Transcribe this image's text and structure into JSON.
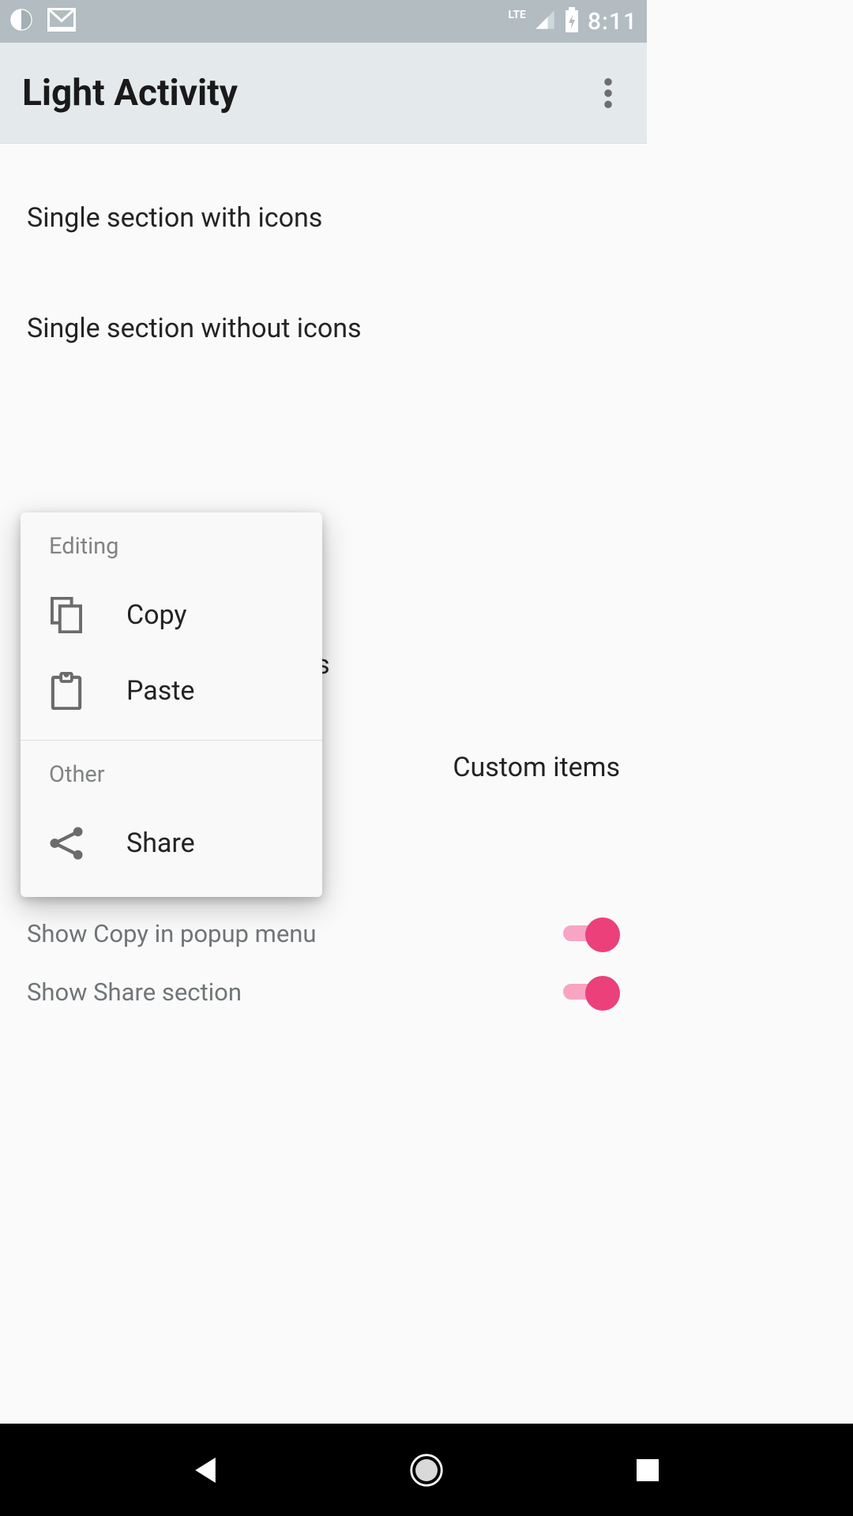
{
  "status": {
    "lte": "LTE",
    "time": "8:11"
  },
  "header": {
    "title": "Light Activity"
  },
  "list": {
    "item1": "Single section with icons",
    "item2": "Single section without icons",
    "obscured_tail": "s",
    "custom_items": "Custom items"
  },
  "toggles": {
    "copy_label": "Show Copy in popup menu",
    "share_label": "Show Share section"
  },
  "popup": {
    "section1": "Editing",
    "copy": "Copy",
    "paste": "Paste",
    "section2": "Other",
    "share": "Share"
  },
  "colors": {
    "accent": "#ec407a"
  }
}
